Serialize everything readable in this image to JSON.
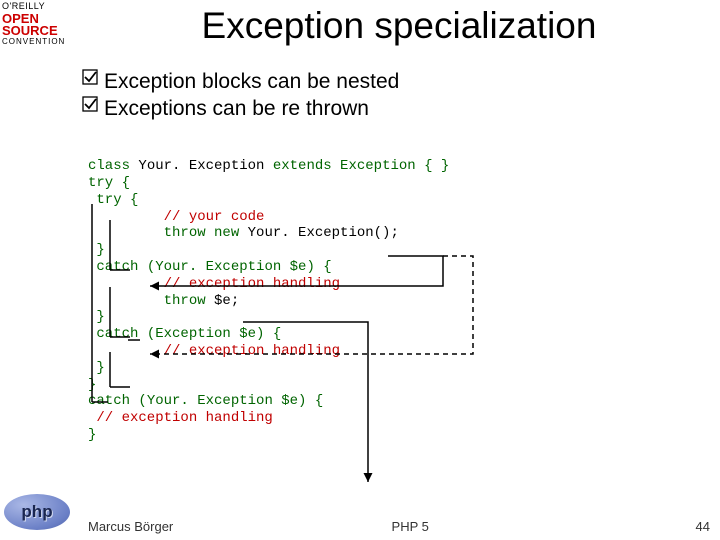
{
  "title": "Exception specialization",
  "bullets": [
    "Exception blocks can be nested",
    "Exceptions can be re thrown"
  ],
  "code": {
    "l1a": "class",
    "l1b": " Your. Exception ",
    "l1c": "extends",
    "l1d": " Exception { }",
    "l2": "try {",
    "l3": " try {",
    "l4": "         // your code",
    "l5a": "         throw new",
    "l5b": " Your. Exception();",
    "l6": " }",
    "l7a": " catch",
    "l7b": " (Your. Exception $e) {",
    "l8": "         // exception handling",
    "l9a": "         throw",
    "l9b": " $e;",
    "l10": " }",
    "l11a": " catch",
    "l11b": " (Exception $e) {",
    "l12": "         // exception handling",
    "l13": " }",
    "l14": "}",
    "l15a": "catch",
    "l15b": " (Your. Exception $e) {",
    "l16": " // exception handling",
    "l17": "}"
  },
  "footer": {
    "left": "Marcus Börger",
    "center": "PHP 5",
    "right": "44"
  },
  "logos": {
    "oreilly_top": "O'REILLY",
    "oreilly_open": "OPEN",
    "oreilly_source": "SOURCE",
    "oreilly_conv": "CONVENTION",
    "php": "php"
  }
}
